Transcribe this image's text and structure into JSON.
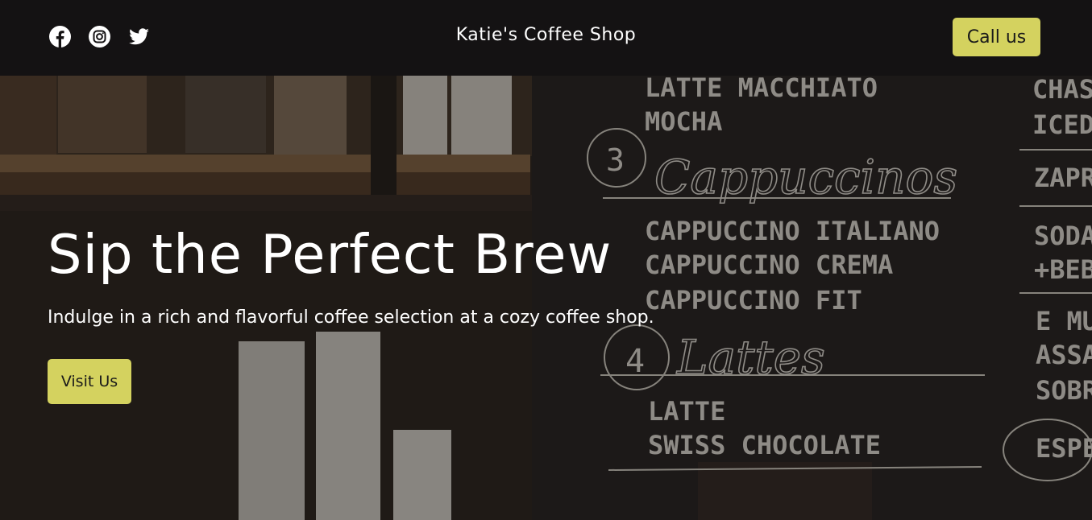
{
  "header": {
    "brand": "Katie's Coffee Shop",
    "call_label": "Call us",
    "socials": [
      {
        "icon": "facebook-icon"
      },
      {
        "icon": "instagram-icon"
      },
      {
        "icon": "twitter-icon"
      }
    ]
  },
  "hero": {
    "title": "Sip the Perfect Brew",
    "subtitle": "Indulge in a rich and flavorful coffee selection at a cozy coffee shop.",
    "cta_label": "Visit Us",
    "menu_board": {
      "lines_top": [
        "LATTE MACCHIATO",
        "MOCHA"
      ],
      "section3_number": "3",
      "section3_title": "Cappuccinos",
      "section3_items": [
        "CAPPUCCINO ITALIANO",
        "CAPPUCCINO CREMA",
        "CAPPUCCINO FIT"
      ],
      "section4_number": "4",
      "section4_title": "Lattes",
      "section4_items": [
        "LATTE",
        "SWISS CHOCOLATE"
      ],
      "right_column": [
        "CHAS",
        "ICED",
        "ZAPR",
        "SODA",
        "+BEB",
        "E MU",
        "ASSA",
        "SOBR",
        "ESPE"
      ]
    }
  },
  "colors": {
    "accent": "#d4d25f",
    "topbar": "#141213",
    "hero_overlay": "#2c2624"
  }
}
